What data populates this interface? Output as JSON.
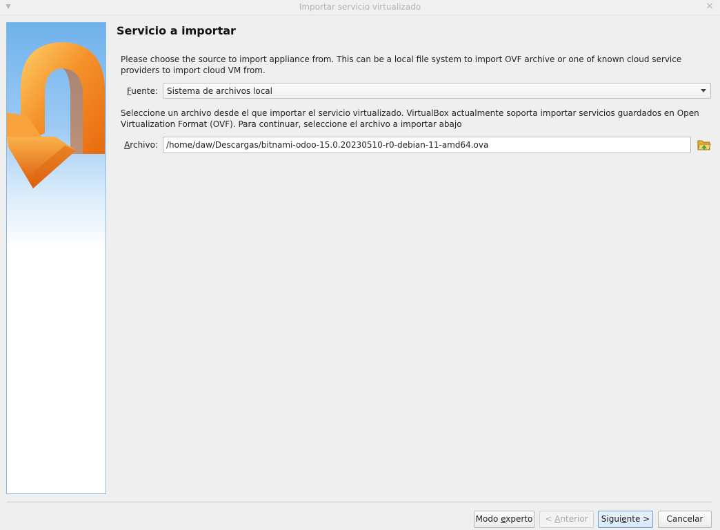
{
  "window": {
    "title": "Importar servicio virtualizado",
    "menu_icon": "chevron-down-icon",
    "close_icon": "close-icon"
  },
  "page": {
    "title": "Servicio a importar",
    "source_description": "Please choose the source to import appliance from. This can be a local file system to import OVF archive or one of known cloud service providers to import cloud VM from.",
    "file_description": "Seleccione un archivo desde el que importar el servicio virtualizado. VirtualBox actualmente soporta importar servicios guardados en Open Virtualization Format (OVF). Para continuar, seleccione el archivo a importar abajo"
  },
  "source": {
    "label_mnemonic": "F",
    "label_rest": "uente:",
    "selected": "Sistema de archivos local"
  },
  "file": {
    "label_mnemonic": "A",
    "label_rest": "rchivo:",
    "value": "/home/daw/Descargas/bitnami-odoo-15.0.20230510-r0-debian-11-amd64.ova",
    "browse_icon": "folder-open-icon"
  },
  "buttons": {
    "expert_pre": "Modo ",
    "expert_mn": "e",
    "expert_post": "xperto",
    "back_pre": "< ",
    "back_mn": "A",
    "back_post": "nterior",
    "next_pre": "Sigui",
    "next_mn": "e",
    "next_post": "nte >",
    "cancel": "Cancelar"
  },
  "colors": {
    "accent": "#6a9fd6",
    "arrow_orange": "#f28a1e",
    "panel_blue": "#6fb2ec"
  }
}
